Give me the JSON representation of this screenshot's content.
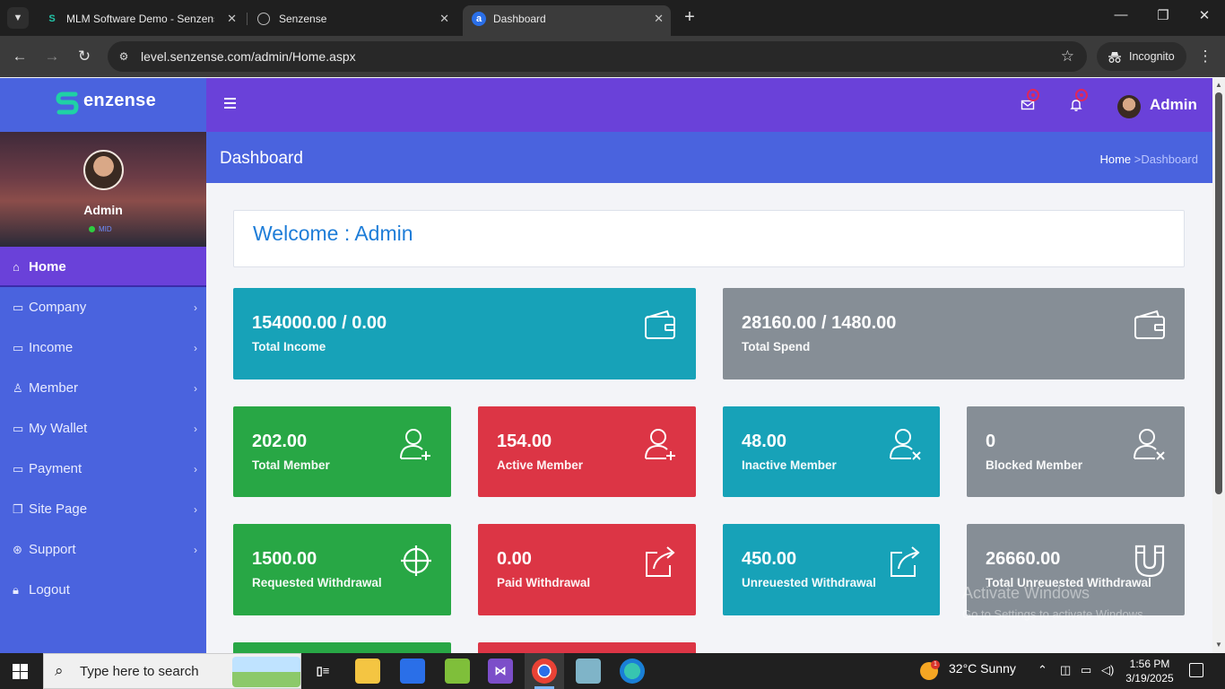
{
  "browser": {
    "tabs": [
      {
        "title": "MLM Software Demo - Senzense",
        "favicon": "S"
      },
      {
        "title": "Senzense",
        "favicon": "globe"
      },
      {
        "title": "Dashboard",
        "favicon": "a"
      }
    ],
    "url": "level.senzense.com/admin/Home.aspx",
    "incognito_label": "Incognito"
  },
  "sidebar": {
    "brand": "enzense",
    "profile_name": "Admin",
    "profile_status": "MID",
    "menu": [
      {
        "label": "Home",
        "icon": "home-icon",
        "active": true
      },
      {
        "label": "Company",
        "icon": "monitor-icon"
      },
      {
        "label": "Income",
        "icon": "folder-icon"
      },
      {
        "label": "Member",
        "icon": "user-icon"
      },
      {
        "label": "My Wallet",
        "icon": "folder-icon"
      },
      {
        "label": "Payment",
        "icon": "folder-icon"
      },
      {
        "label": "Site Page",
        "icon": "pages-icon"
      },
      {
        "label": "Support",
        "icon": "lifebuoy-icon"
      },
      {
        "label": "Logout",
        "icon": "lock-icon"
      }
    ]
  },
  "header": {
    "user_name": "Admin"
  },
  "breadcrumb": {
    "title": "Dashboard",
    "home": "Home",
    "separator": ">",
    "current": "Dashboard"
  },
  "welcome": "Welcome : Admin",
  "cards": {
    "total_income": {
      "value": "154000.00 / 0.00",
      "label": "Total Income",
      "color": "#17a2b8"
    },
    "total_spend": {
      "value": "28160.00 / 1480.00",
      "label": "Total Spend",
      "color": "#868e96"
    },
    "total_member": {
      "value": "202.00",
      "label": "Total Member",
      "color": "#28a745"
    },
    "active_member": {
      "value": "154.00",
      "label": "Active Member",
      "color": "#dc3545"
    },
    "inactive_member": {
      "value": "48.00",
      "label": "Inactive Member",
      "color": "#17a2b8"
    },
    "blocked_member": {
      "value": "0",
      "label": "Blocked Member",
      "color": "#868e96"
    },
    "requested_withdrawal": {
      "value": "1500.00",
      "label": "Requested Withdrawal",
      "color": "#28a745"
    },
    "paid_withdrawal": {
      "value": "0.00",
      "label": "Paid Withdrawal",
      "color": "#dc3545"
    },
    "unrequested_withdrawal": {
      "value": "450.00",
      "label": "Unreuested Withdrawal",
      "color": "#17a2b8"
    },
    "total_unrequested_withdrawal": {
      "value": "26660.00",
      "label": "Total Unreuested Withdrawal",
      "color": "#868e96"
    }
  },
  "watermark": {
    "line1": "Activate Windows",
    "line2": "Go to Settings to activate Windows."
  },
  "taskbar": {
    "search_placeholder": "Type here to search",
    "weather": "32°C  Sunny",
    "weather_badge": "1",
    "time": "1:56 PM",
    "date": "3/19/2025"
  }
}
